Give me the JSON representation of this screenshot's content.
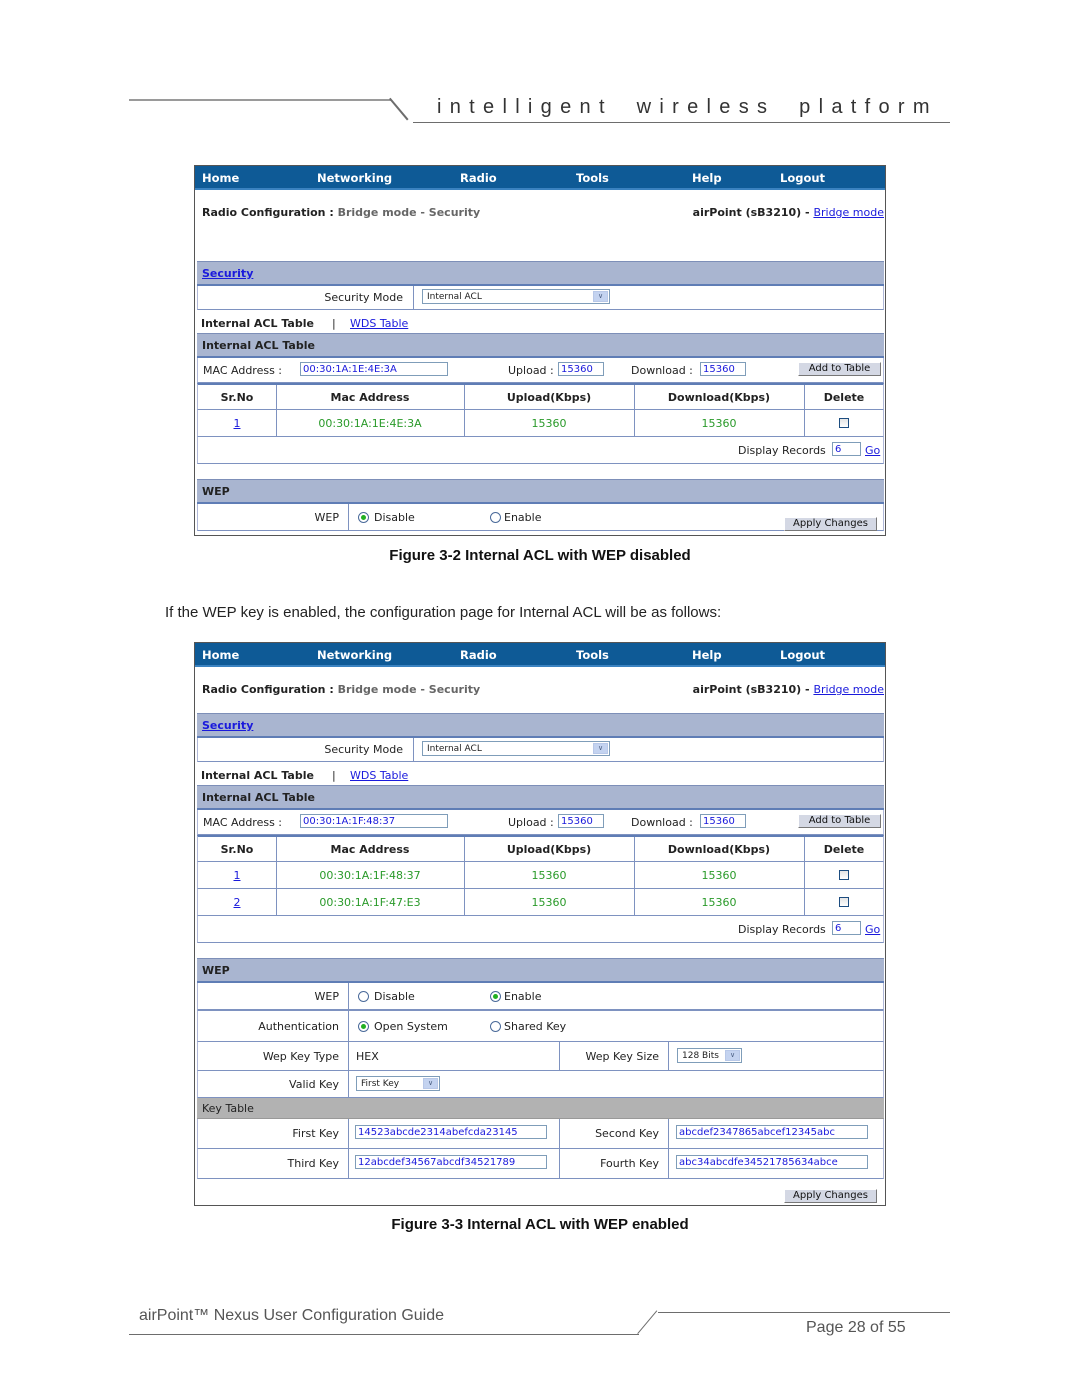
{
  "header": {
    "tagline": "intelligent  wireless  platform"
  },
  "nav": [
    "Home",
    "Networking",
    "Radio",
    "Tools",
    "Help",
    "Logout"
  ],
  "breadcrumb": {
    "label": "Radio Configuration :",
    "path": "Bridge mode -  Security",
    "device": "airPoint (sB3210) -",
    "mode_link": "Bridge mode"
  },
  "security": {
    "section_title": "Security",
    "mode_label": "Security Mode",
    "mode_value": "Internal ACL",
    "arrow": "∨"
  },
  "tabs": {
    "active": "Internal ACL Table",
    "separator": "|",
    "other": "WDS Table"
  },
  "acl": {
    "section_title": "Internal ACL Table",
    "mac_label": "MAC Address :",
    "upload_label": "Upload :",
    "download_label": "Download :",
    "add_button": "Add to Table",
    "columns": [
      "Sr.No",
      "Mac Address",
      "Upload(Kbps)",
      "Download(Kbps)",
      "Delete"
    ],
    "display_records_label": "Display Records",
    "display_records_value": "6",
    "go_label": "Go"
  },
  "wep": {
    "section_title": "WEP",
    "wep_label": "WEP",
    "disable_label": "Disable",
    "enable_label": "Enable",
    "auth_label": "Authentication",
    "open_label": "Open System",
    "shared_label": "Shared Key",
    "key_type_label": "Wep Key Type",
    "key_type_value": "HEX",
    "key_size_label": "Wep Key Size",
    "key_size_value": "128 Bits",
    "valid_key_label": "Valid Key",
    "valid_key_value": "First Key",
    "key_table_title": "Key Table",
    "first_key_label": "First Key",
    "second_key_label": "Second Key",
    "third_key_label": "Third Key",
    "fourth_key_label": "Fourth Key",
    "first_key": "14523abcde2314abefcda23145",
    "second_key": "abcdef2347865abcef12345abc",
    "third_key": "12abcdef34567abcdf34521789",
    "fourth_key": "abc34abcdfe34521785634abce"
  },
  "apply_button": "Apply Changes",
  "fig1": {
    "mac_input": "00:30:1A:1E:4E:3A",
    "upload_input": "15360",
    "download_input": "15360",
    "rows": [
      {
        "no": "1",
        "mac": "00:30:1A:1E:4E:3A",
        "up": "15360",
        "down": "15360"
      }
    ],
    "wep_state": "Disable",
    "caption": "Figure 3-2 Internal ACL with WEP disabled"
  },
  "paragraph": "If the WEP key is enabled, the configuration page for Internal ACL will be as follows:",
  "fig2": {
    "mac_input": "00:30:1A:1F:48:37",
    "upload_input": "15360",
    "download_input": "15360",
    "rows": [
      {
        "no": "1",
        "mac": "00:30:1A:1F:48:37",
        "up": "15360",
        "down": "15360"
      },
      {
        "no": "2",
        "mac": "00:30:1A:1F:47:E3",
        "up": "15360",
        "down": "15360"
      }
    ],
    "wep_state": "Enable",
    "auth_state": "Open System",
    "caption": "Figure 3-3 Internal ACL with WEP enabled"
  },
  "footer": {
    "title": "airPoint™ Nexus User Configuration Guide",
    "page": "Page 28 of 55"
  }
}
